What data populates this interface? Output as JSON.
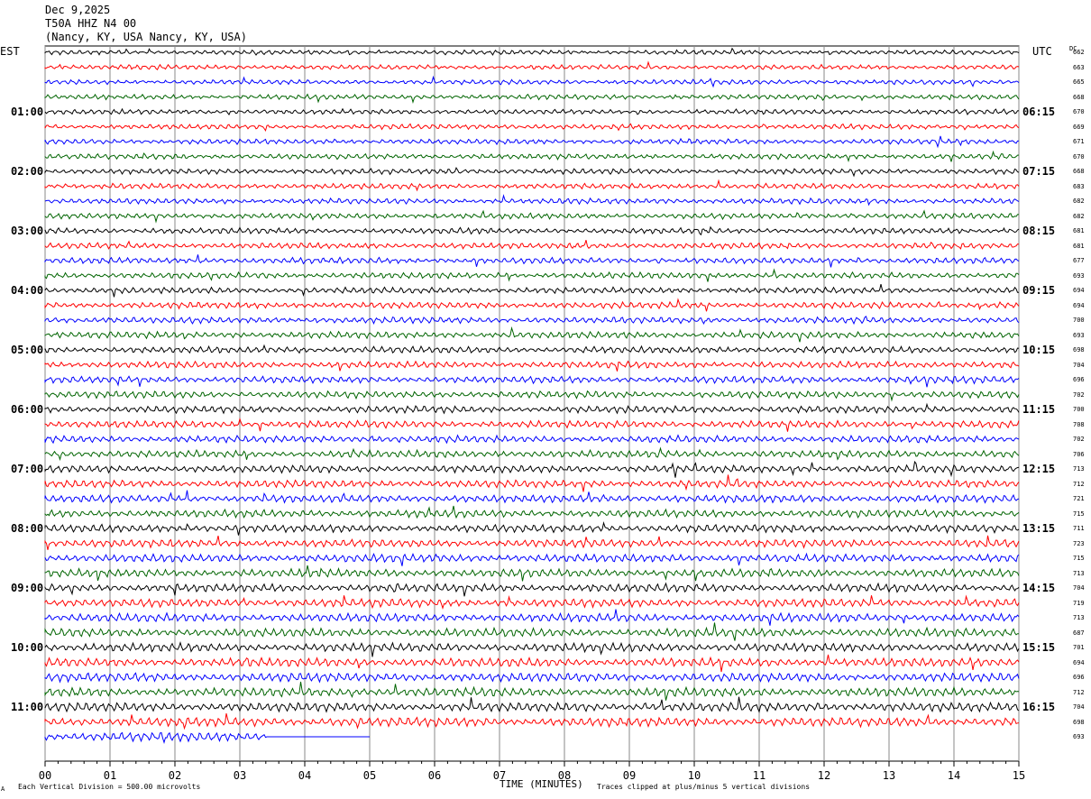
{
  "header": {
    "date": "Dec 9,2025",
    "station": "T50A HHZ N4 00",
    "location": "(Nancy, KY, USA Nancy, KY, USA)"
  },
  "axes": {
    "left_title": "EST",
    "right_title": "UTC",
    "dc_title": "DC",
    "x_title": "TIME (MINUTES)"
  },
  "footer": {
    "scale_note": "Each Vertical Division =  500.00 microvolts",
    "clip_note": "Traces clipped at plus/minus 5 vertical divisions",
    "corner_mark": "A"
  },
  "chart_data": {
    "type": "line",
    "x": [
      "00",
      "01",
      "02",
      "03",
      "04",
      "05",
      "06",
      "07",
      "08",
      "09",
      "10",
      "11",
      "12",
      "13",
      "14",
      "15"
    ],
    "xlim": [
      0,
      15
    ],
    "trace_colors": [
      "#000000",
      "#ff0000",
      "#0000ff",
      "#006400"
    ],
    "hour_labels_est": [
      "01:00",
      "02:00",
      "03:00",
      "04:00",
      "05:00",
      "06:00",
      "07:00",
      "08:00",
      "09:00",
      "10:00",
      "11:00"
    ],
    "hour_labels_utc": [
      "06:15",
      "07:15",
      "08:15",
      "09:15",
      "10:15",
      "11:15",
      "12:15",
      "13:15",
      "14:15",
      "15:15",
      "16:15"
    ],
    "dc_offsets": [
      662,
      663,
      665,
      668,
      670,
      669,
      671,
      670,
      668,
      683,
      682,
      682,
      681,
      681,
      677,
      693,
      694,
      694,
      700,
      693,
      698,
      704,
      696,
      702,
      700,
      708,
      702,
      706,
      713,
      712,
      721,
      715,
      711,
      723,
      715,
      713,
      704,
      719,
      713,
      687,
      701,
      694,
      696,
      712,
      704,
      698,
      693
    ],
    "last_trace_end_minute": 5
  }
}
